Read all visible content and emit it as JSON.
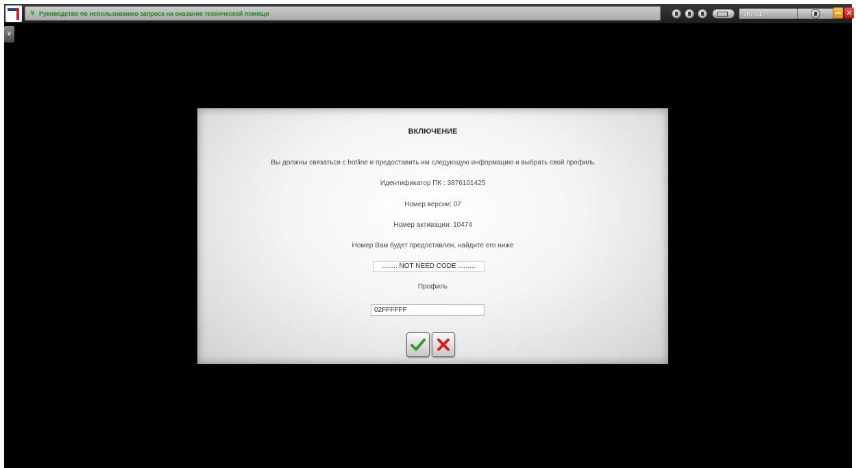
{
  "window": {
    "title": "Руководство по использованию запроса на оказание технической помощи",
    "version": "v07.01"
  },
  "icons": {
    "logo": "app-logo",
    "title_chevron": "chevron-down-icon",
    "tray": [
      "power-icon",
      "profile-icon",
      "settings-icon",
      "battery-icon",
      "dial-icon"
    ],
    "minimize": "minimize-icon",
    "close": "close-icon",
    "dropdown": "chevron-down-icon",
    "confirm": "checkmark-icon",
    "cancel": "cross-icon"
  },
  "colors": {
    "title_text": "#1e8a1e",
    "confirm": "#2e9a2e",
    "cancel": "#d41e1e",
    "close": "#d11a1a",
    "minimize": "#f0a020"
  },
  "dialog": {
    "title": "ВКЛЮЧЕНИЕ",
    "instruction": "Вы должны связаться с hotline и предоставить им следующую информацию и выбрать свой профиль",
    "pc_id": "Идентификатор ПК : 3876101425",
    "version_number": "Номер версии: 07",
    "activation_number": "Номер активации: 10474",
    "note": "Номер Вам будет предоставлен, найдите его ниже",
    "code_value": "........ NOT NEED CODE .........",
    "profile_label": "Профиль",
    "profile_value": "02FFFFFF"
  }
}
